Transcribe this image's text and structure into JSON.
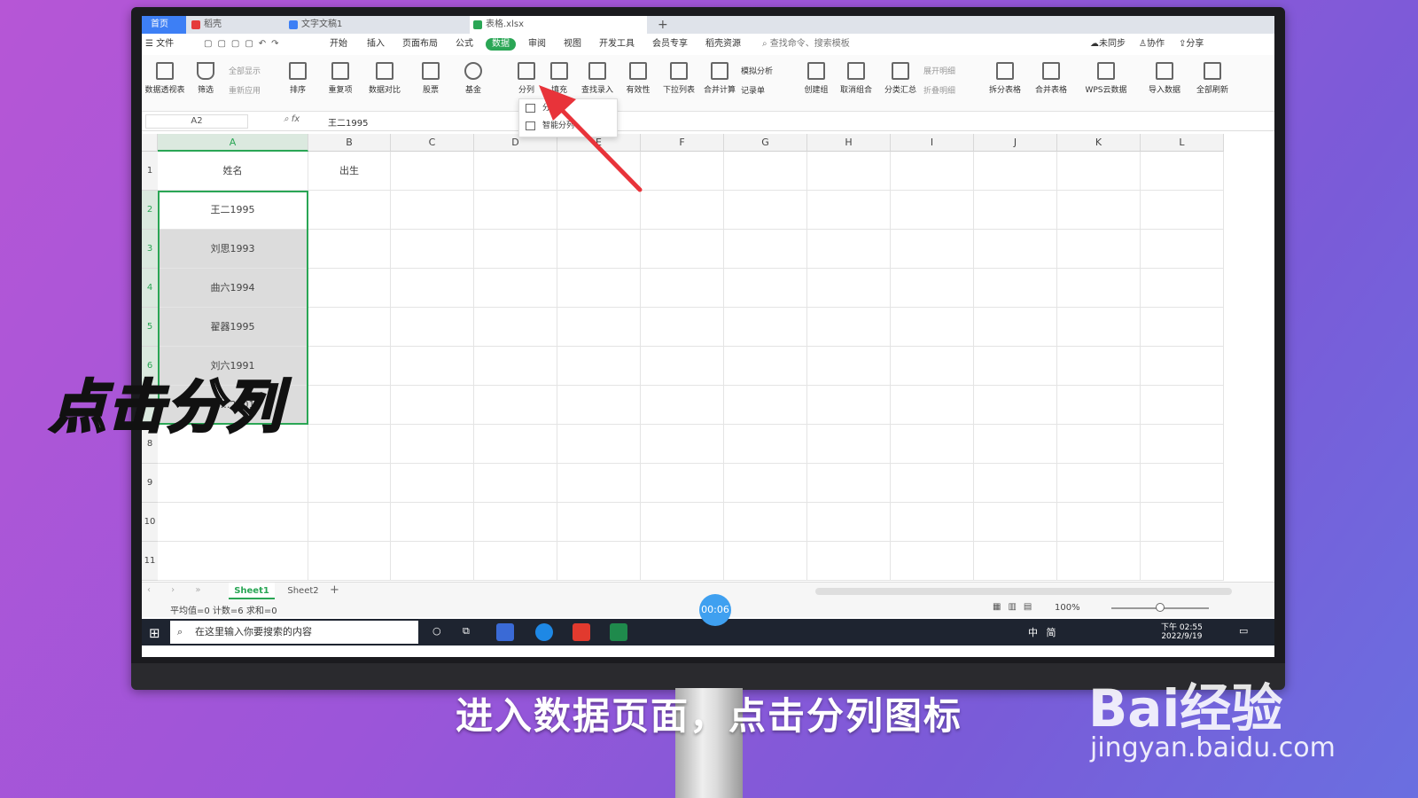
{
  "tabs": [
    {
      "label": "首页"
    },
    {
      "label": "稻壳"
    },
    {
      "label": "文字文稿1"
    },
    {
      "label": "表格.xlsx"
    }
  ],
  "menu": {
    "file": "文件",
    "items": [
      "开始",
      "插入",
      "页面布局",
      "公式",
      "数据",
      "审阅",
      "视图",
      "开发工具",
      "会员专享",
      "稻壳资源"
    ],
    "active": "数据",
    "search": "查找命令、搜索模板",
    "sync": "未同步",
    "collab": "协作",
    "share": "分享"
  },
  "ribbon": {
    "pivot": "数据透视表",
    "filter": "筛选",
    "show_all": "全部显示",
    "reapply": "重新应用",
    "sort": "排序",
    "dup": "重复项",
    "compare": "数据对比",
    "stock": "股票",
    "fund": "基金",
    "split": "分列",
    "fill": "填充",
    "lookup": "查找录入",
    "valid": "有效性",
    "dropdown": "下拉列表",
    "consolidate": "合并计算",
    "whatif": "模拟分析",
    "record": "记录单",
    "group": "创建组",
    "ungroup": "取消组合",
    "subtotal": "分类汇总",
    "expand": "展开明细",
    "collapse": "折叠明细",
    "split_table": "拆分表格",
    "merge_table": "合并表格",
    "wps_cloud": "WPS云数据",
    "import": "导入数据",
    "refresh_all": "全部刷新"
  },
  "split_menu": {
    "items": [
      "分列",
      "智能分列"
    ]
  },
  "formula": {
    "cell_ref": "A2",
    "value": "王二1995"
  },
  "grid": {
    "columns": [
      "A",
      "B",
      "C",
      "D",
      "E",
      "F",
      "G",
      "H",
      "I",
      "J",
      "K",
      "L"
    ],
    "rows": [
      "1",
      "2",
      "3",
      "4",
      "5",
      "6",
      "7",
      "8",
      "9",
      "10",
      "11"
    ],
    "cells": {
      "A1": "姓名",
      "B1": "出生",
      "A2": "王二1995",
      "A3": "刘思1993",
      "A4": "曲六1994",
      "A5": "翟器1995",
      "A6": "刘六1991",
      "A7": "李…2001"
    }
  },
  "sheets": {
    "tabs": [
      "Sheet1",
      "Sheet2"
    ],
    "active": "Sheet1"
  },
  "status": {
    "stats": "平均值=0 计数=6 求和=0",
    "zoom": "100%"
  },
  "taskbar": {
    "search_placeholder": "在这里输入你要搜索的内容",
    "time": "下午 02:55",
    "date": "2022/9/19",
    "ime": "中",
    "lang": "简"
  },
  "video": {
    "timer": "00:06"
  },
  "overlay": {
    "title": "点击分列",
    "subtitle": "进入数据页面，点击分列图标"
  },
  "watermark": {
    "brand": "Bai经验",
    "url": "jingyan.baidu.com"
  },
  "colors": {
    "accent_green": "#2aa655",
    "tab_blue": "#3d7ff5",
    "arrow_red": "#e8333a",
    "timer_blue": "#3fa0f0"
  }
}
